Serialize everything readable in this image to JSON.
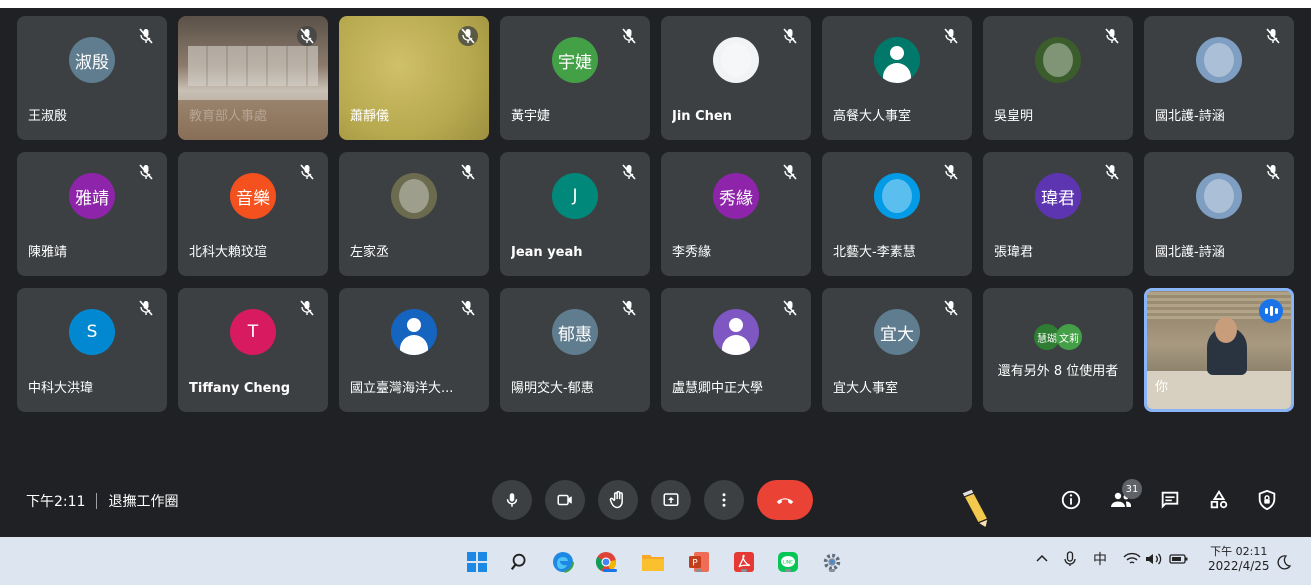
{
  "participants": [
    {
      "name": "王淑殷",
      "avatar_text": "淑殷",
      "avatar_color": "#5f7d8f",
      "kind": "letter"
    },
    {
      "name": "教育部人事處",
      "kind": "video-room"
    },
    {
      "name": "蕭靜儀",
      "kind": "video-yellow"
    },
    {
      "name": "黃宇婕",
      "avatar_text": "宇婕",
      "avatar_color": "#43a047",
      "kind": "letter"
    },
    {
      "name": "Jin Chen",
      "kind": "image",
      "avatar_color": "#f1f3f4",
      "image_icon": "cartoon-boy-avatar-icon"
    },
    {
      "name": "高餐大人事室",
      "kind": "person",
      "avatar_color": "#00796b"
    },
    {
      "name": "吳皇明",
      "kind": "image",
      "avatar_color": "#3b5d2c",
      "image_icon": "cat-photo-avatar-icon"
    },
    {
      "name": "國北護-詩涵",
      "kind": "image",
      "avatar_color": "#7e9ec2",
      "image_icon": "family-photo-avatar-icon"
    },
    {
      "name": "陳雅靖",
      "avatar_text": "雅靖",
      "avatar_color": "#8e24aa",
      "kind": "letter"
    },
    {
      "name": "北科大賴玟瑄",
      "avatar_text": "音樂",
      "avatar_color": "#f4511e",
      "kind": "letter"
    },
    {
      "name": "左家丞",
      "kind": "image",
      "avatar_color": "#6b6b4f",
      "image_icon": "flower-photo-avatar-icon"
    },
    {
      "name": "Jean yeah",
      "avatar_text": "J",
      "avatar_color": "#00897b",
      "kind": "letter"
    },
    {
      "name": "李秀緣",
      "avatar_text": "秀緣",
      "avatar_color": "#8e24aa",
      "kind": "letter"
    },
    {
      "name": "北藝大-李素慧",
      "kind": "image",
      "avatar_color": "#039be5",
      "image_icon": "bird-logo-avatar-icon"
    },
    {
      "name": "張瑋君",
      "avatar_text": "瑋君",
      "avatar_color": "#5e35b1",
      "kind": "letter"
    },
    {
      "name": "國北護-詩涵",
      "kind": "image",
      "avatar_color": "#7e9ec2",
      "image_icon": "family-photo-avatar-icon"
    },
    {
      "name": "中科大洪瑋",
      "avatar_text": "S",
      "avatar_color": "#0288d1",
      "kind": "letter"
    },
    {
      "name": "Tiffany Cheng",
      "avatar_text": "T",
      "avatar_color": "#d81b60",
      "kind": "letter"
    },
    {
      "name": "國立臺灣海洋大...",
      "kind": "person",
      "avatar_color": "#1565c0"
    },
    {
      "name": "陽明交大-郁惠",
      "avatar_text": "郁惠",
      "avatar_color": "#5f7d8f",
      "kind": "letter"
    },
    {
      "name": "盧慧卿中正大學",
      "kind": "person",
      "avatar_color": "#7e57c2"
    },
    {
      "name": "宜大人事室",
      "avatar_text": "宜大",
      "avatar_color": "#5f7d8f",
      "kind": "letter"
    }
  ],
  "overflow_tile": {
    "text": "還有另外 8 位使用者",
    "avatars": [
      {
        "text": "慧瑚",
        "color": "#2e7d32"
      },
      {
        "text": "文莉",
        "color": "#43a047"
      }
    ]
  },
  "self_tile": {
    "label": "你"
  },
  "meeting": {
    "time": "下午2:11",
    "title": "退撫工作圈"
  },
  "controls": {
    "mic_icon": "microphone-icon",
    "camera_icon": "camera-icon",
    "hand_icon": "raise-hand-icon",
    "present_icon": "present-screen-icon",
    "more_icon": "more-options-icon",
    "end_icon": "end-call-icon",
    "end_color": "#ea4335"
  },
  "right_panel": {
    "info_icon": "info-icon",
    "people_icon": "people-icon",
    "people_count": "31",
    "chat_icon": "chat-icon",
    "activities_icon": "activities-icon",
    "host_icon": "host-controls-icon"
  },
  "taskbar": {
    "apps": [
      "windows-start-icon",
      "search-icon",
      "edge-icon",
      "chrome-icon",
      "file-explorer-icon",
      "powerpoint-icon",
      "acrobat-icon",
      "line-icon",
      "settings-icon"
    ],
    "tray": {
      "ime": "中",
      "time": "下午 02:11",
      "date": "2022/4/25"
    }
  },
  "colors": {
    "background": "#202124",
    "tile": "#3c4043",
    "self_border": "#8ab4f8",
    "taskbar": "#dde5f0"
  }
}
